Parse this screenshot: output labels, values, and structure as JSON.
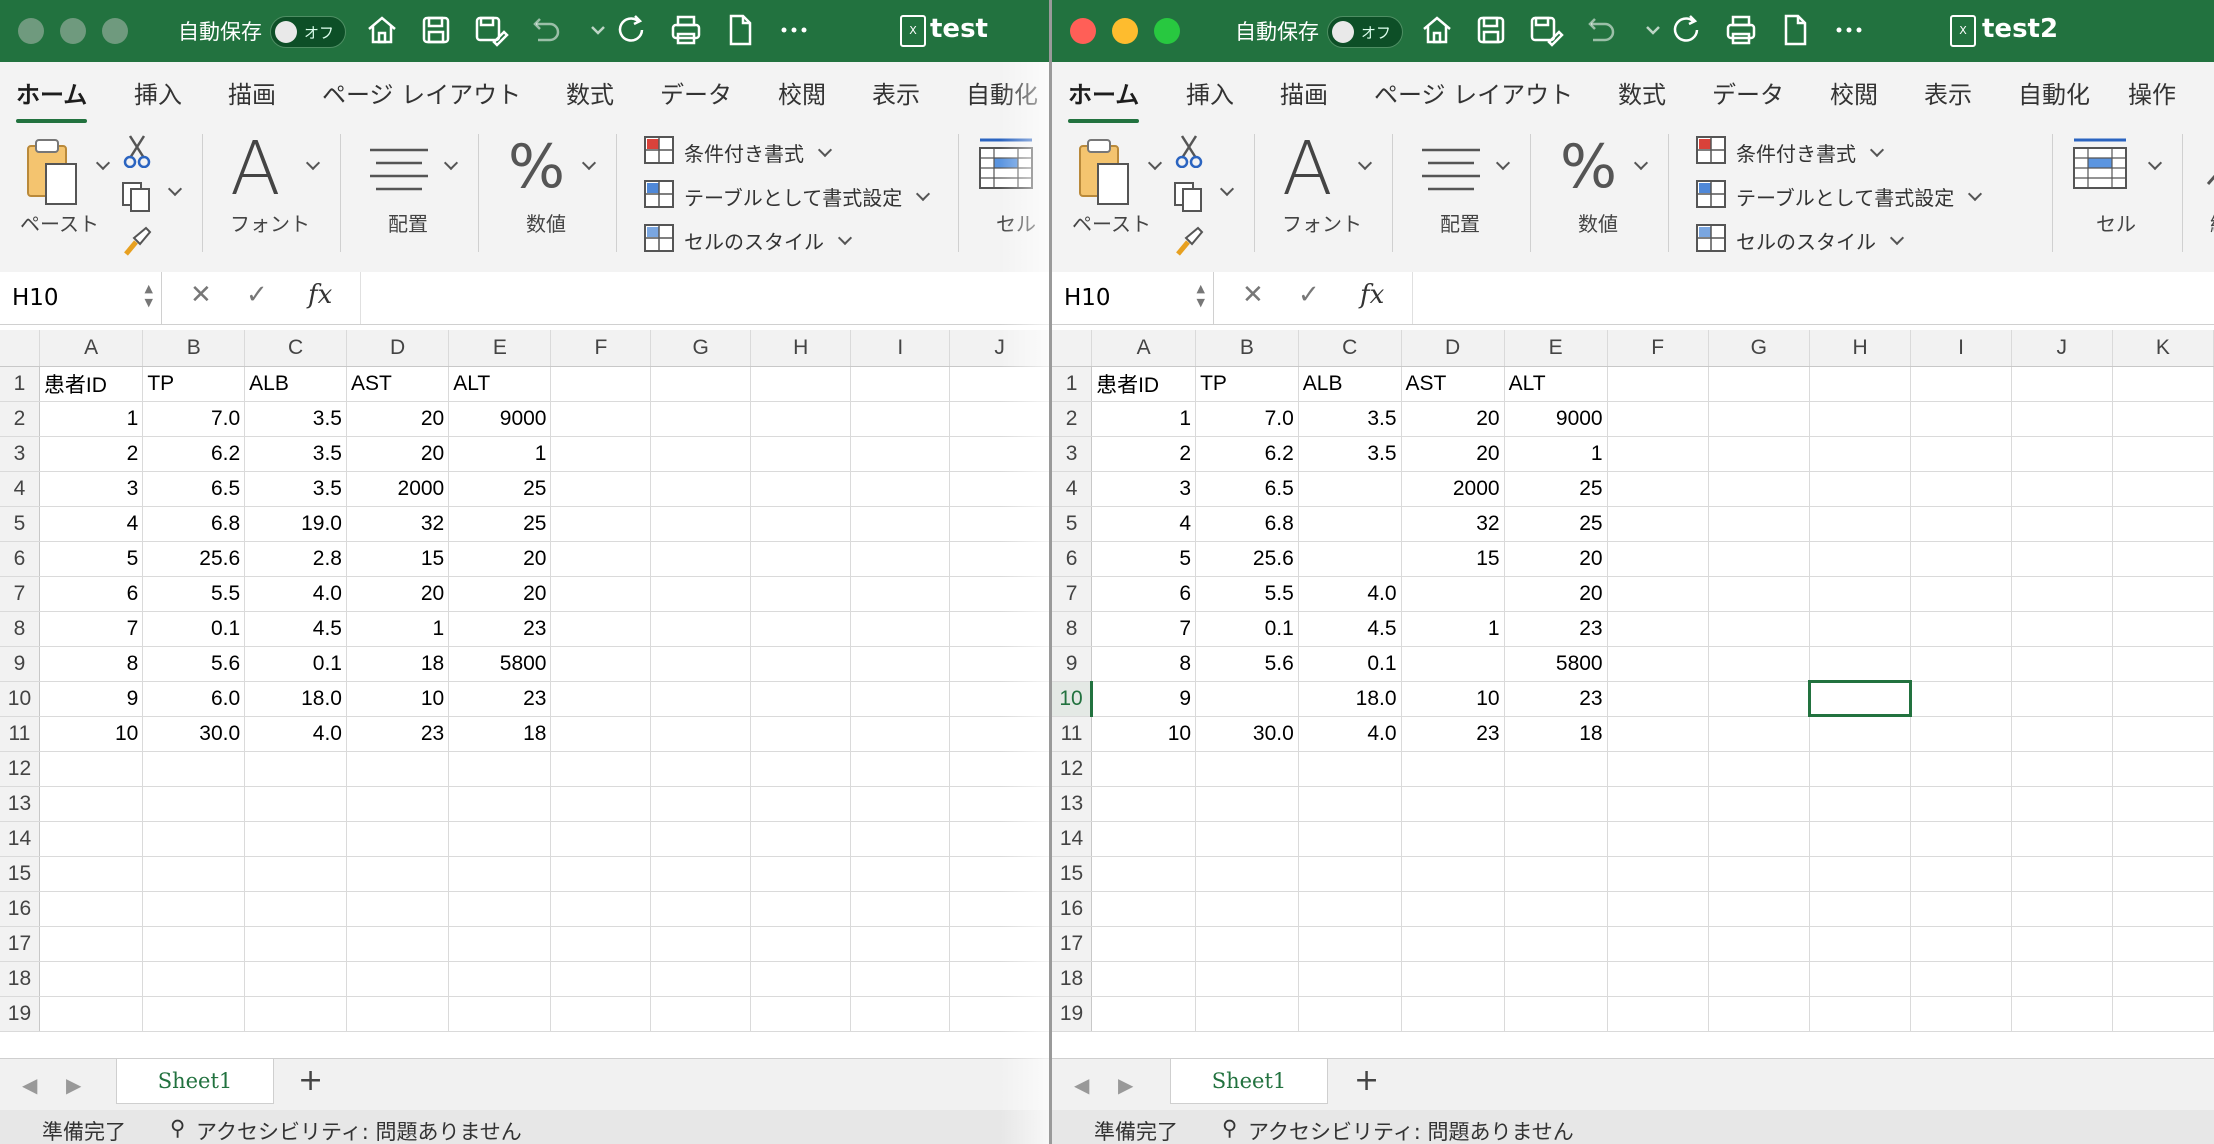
{
  "windows": [
    {
      "id": "left",
      "title": "test",
      "active": false,
      "autosave_label": "自動保存",
      "autosave_state": "オフ",
      "menus": [
        "ホーム",
        "挿入",
        "描画",
        "ページ レイアウト",
        "数式",
        "データ",
        "校閲",
        "表示",
        "自動化"
      ],
      "ribbon": {
        "paste": "ペースト",
        "font": "フォント",
        "align": "配置",
        "number": "数値",
        "cond_format": "条件付き書式",
        "table_format": "テーブルとして書式設定",
        "cell_style": "セルのスタイル",
        "cells": "セル"
      },
      "namebox": "H10",
      "columns": [
        "A",
        "B",
        "C",
        "D",
        "E",
        "F",
        "G",
        "H",
        "I",
        "J"
      ],
      "rows": [
        [
          "患者ID",
          "TP",
          "ALB",
          "AST",
          "ALT"
        ],
        [
          "1",
          "7.0",
          "3.5",
          "20",
          "9000"
        ],
        [
          "2",
          "6.2",
          "3.5",
          "20",
          "1"
        ],
        [
          "3",
          "6.5",
          "3.5",
          "2000",
          "25"
        ],
        [
          "4",
          "6.8",
          "19.0",
          "32",
          "25"
        ],
        [
          "5",
          "25.6",
          "2.8",
          "15",
          "20"
        ],
        [
          "6",
          "5.5",
          "4.0",
          "20",
          "20"
        ],
        [
          "7",
          "0.1",
          "4.5",
          "1",
          "23"
        ],
        [
          "8",
          "5.6",
          "0.1",
          "18",
          "5800"
        ],
        [
          "9",
          "6.0",
          "18.0",
          "10",
          "23"
        ],
        [
          "10",
          "30.0",
          "4.0",
          "23",
          "18"
        ],
        [],
        [],
        [],
        [],
        [],
        [],
        [],
        []
      ],
      "row_numbers": [
        "1",
        "2",
        "3",
        "4",
        "5",
        "6",
        "7",
        "8",
        "9",
        "10",
        "11",
        "12",
        "13",
        "14",
        "15",
        "16",
        "17",
        "18",
        "19"
      ],
      "sheet_tab": "Sheet1",
      "status_ready": "準備完了",
      "status_access": "アクセシビリティ: 問題ありません"
    },
    {
      "id": "right",
      "title": "test2",
      "active": true,
      "autosave_label": "自動保存",
      "autosave_state": "オフ",
      "menus": [
        "ホーム",
        "挿入",
        "描画",
        "ページ レイアウト",
        "数式",
        "データ",
        "校閲",
        "表示",
        "自動化",
        "操作"
      ],
      "ribbon": {
        "paste": "ペースト",
        "font": "フォント",
        "align": "配置",
        "number": "数値",
        "cond_format": "条件付き書式",
        "table_format": "テーブルとして書式設定",
        "cell_style": "セルのスタイル",
        "cells": "セル",
        "edit": "編"
      },
      "namebox": "H10",
      "columns": [
        "A",
        "B",
        "C",
        "D",
        "E",
        "F",
        "G",
        "H",
        "I",
        "J",
        "K"
      ],
      "rows": [
        [
          "患者ID",
          "TP",
          "ALB",
          "AST",
          "ALT"
        ],
        [
          "1",
          "7.0",
          "3.5",
          "20",
          "9000"
        ],
        [
          "2",
          "6.2",
          "3.5",
          "20",
          "1"
        ],
        [
          "3",
          "6.5",
          "",
          "2000",
          "25"
        ],
        [
          "4",
          "6.8",
          "",
          "32",
          "25"
        ],
        [
          "5",
          "25.6",
          "",
          "15",
          "20"
        ],
        [
          "6",
          "5.5",
          "4.0",
          "",
          "20"
        ],
        [
          "7",
          "0.1",
          "4.5",
          "1",
          "23"
        ],
        [
          "8",
          "5.6",
          "0.1",
          "",
          "5800"
        ],
        [
          "9",
          "",
          "18.0",
          "10",
          "23"
        ],
        [
          "10",
          "30.0",
          "4.0",
          "23",
          "18"
        ],
        [],
        [],
        [],
        [],
        [],
        [],
        [],
        []
      ],
      "row_numbers": [
        "1",
        "2",
        "3",
        "4",
        "5",
        "6",
        "7",
        "8",
        "9",
        "10",
        "11",
        "12",
        "13",
        "14",
        "15",
        "16",
        "17",
        "18",
        "19"
      ],
      "selected_cell": {
        "col": "H",
        "row": "10"
      },
      "sheet_tab": "Sheet1",
      "status_ready": "準備完了",
      "status_access": "アクセシビリティ: 問題ありません"
    }
  ]
}
